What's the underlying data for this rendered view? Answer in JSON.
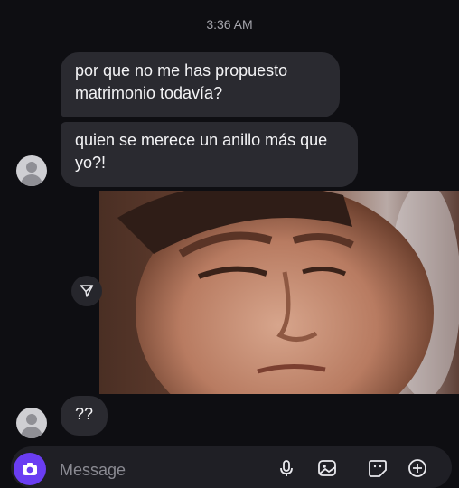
{
  "thread": {
    "timestamp": "3:36 AM",
    "messages": [
      {
        "text": "por que no me has propuesto\nmatrimonio todavía?"
      },
      {
        "text": "quien se merece un anillo más que\nyo?!"
      },
      {
        "text": "??"
      }
    ]
  },
  "composer": {
    "placeholder": "Message"
  },
  "icons": {
    "avatar": "person-avatar-icon",
    "share": "send-share-icon",
    "camera": "camera-icon",
    "mic": "microphone-icon",
    "gallery": "image-gallery-icon",
    "sticker": "sticker-icon",
    "add": "plus-circle-icon"
  },
  "colors": {
    "background": "#0e0e12",
    "bubble": "#2a2a30",
    "accent": "#6a3df2"
  }
}
